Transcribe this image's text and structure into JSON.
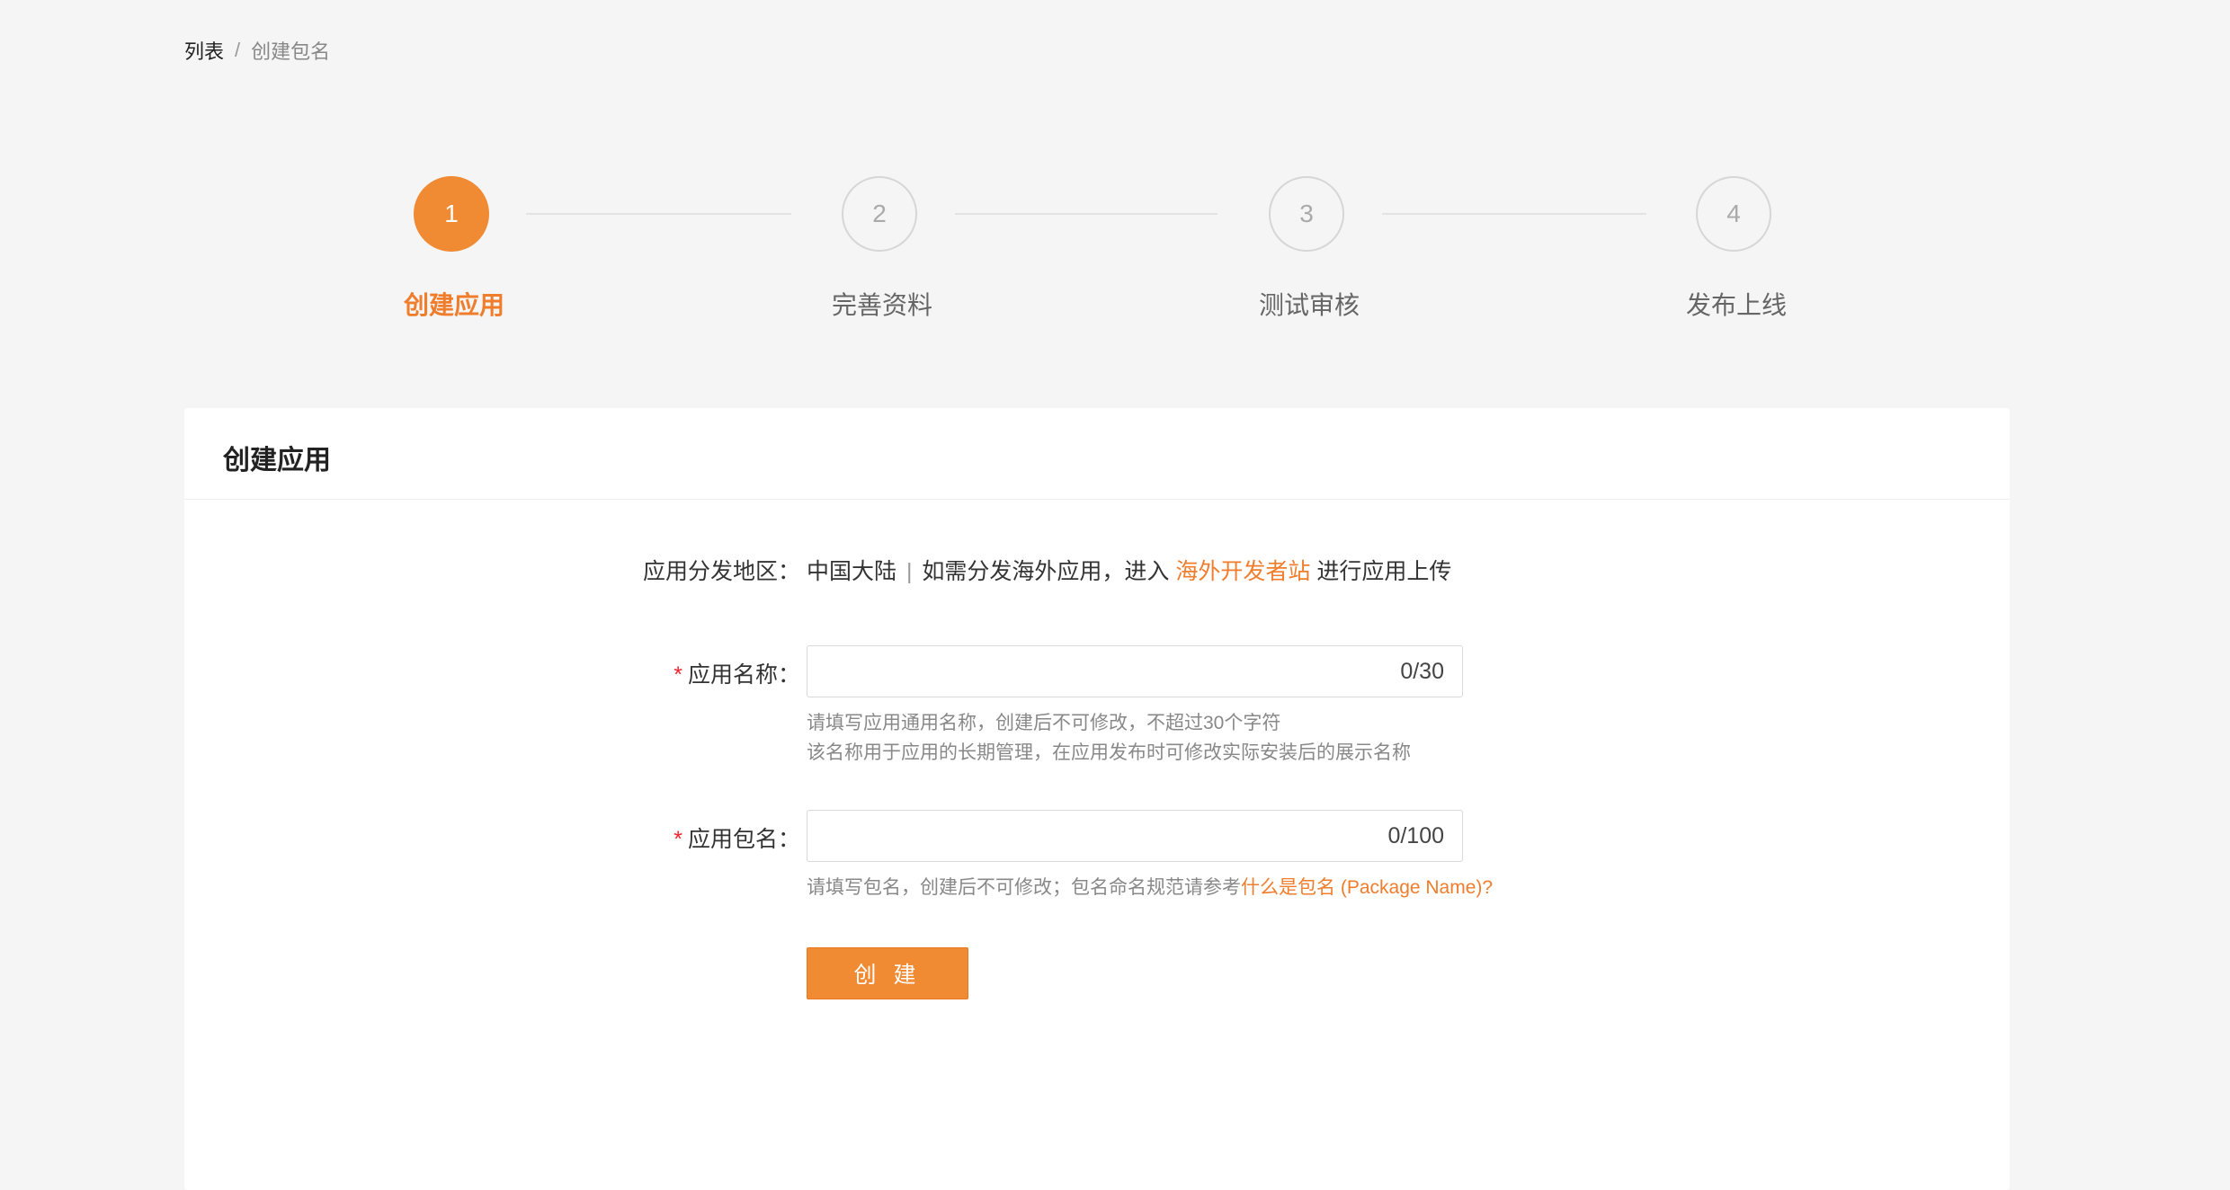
{
  "breadcrumb": {
    "parent": "列表",
    "separator": "/",
    "current": "创建包名"
  },
  "steps": [
    {
      "number": "1",
      "label": "创建应用",
      "active": true
    },
    {
      "number": "2",
      "label": "完善资料",
      "active": false
    },
    {
      "number": "3",
      "label": "测试审核",
      "active": false
    },
    {
      "number": "4",
      "label": "发布上线",
      "active": false
    }
  ],
  "card": {
    "title": "创建应用"
  },
  "region": {
    "label": "应用分发地区：",
    "value": "中国大陆",
    "pipe": "|",
    "note_prefix": "如需分发海外应用，进入",
    "link": "海外开发者站",
    "note_suffix": "进行应用上传"
  },
  "app_name": {
    "required_mark": "*",
    "label": "应用名称：",
    "counter": "0/30",
    "help_line1": "请填写应用通用名称，创建后不可修改，不超过30个字符",
    "help_line2": "该名称用于应用的长期管理，在应用发布时可修改实际安装后的展示名称"
  },
  "package_name": {
    "required_mark": "*",
    "label": "应用包名：",
    "counter": "0/100",
    "help_prefix": "请填写包名，创建后不可修改；包名命名规范请参考",
    "help_link": "什么是包名 (Package Name)?"
  },
  "create_button": "创 建",
  "colors": {
    "accent": "#f08a33",
    "required": "#f5222d"
  }
}
